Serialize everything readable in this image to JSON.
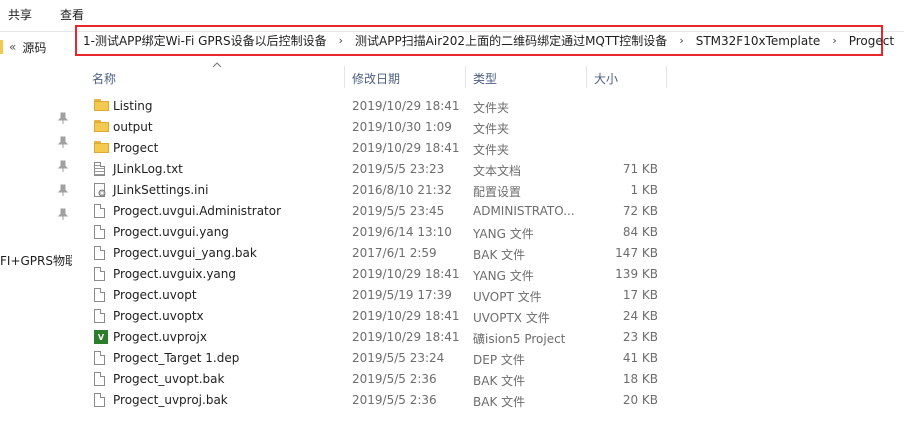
{
  "ribbon": {
    "share": "共享",
    "view": "查看"
  },
  "address": {
    "overflow": "«",
    "root": "源码",
    "crumbs": [
      "1-测试APP绑定Wi-Fi  GPRS设备以后控制设备",
      "测试APP扫描Air202上面的二维码绑定通过MQTT控制设备",
      "STM32F10xTemplate",
      "Progect"
    ],
    "separator": "›"
  },
  "nav": {
    "truncated_item": "FI+GPRS物联"
  },
  "columns": {
    "name": "名称",
    "date": "修改日期",
    "type": "类型",
    "size": "大小"
  },
  "files": [
    {
      "name": "Listing",
      "date": "2019/10/29 18:41",
      "type": "文件夹",
      "size": "",
      "icon": "folder-icon"
    },
    {
      "name": "output",
      "date": "2019/10/30 1:09",
      "type": "文件夹",
      "size": "",
      "icon": "folder-icon"
    },
    {
      "name": "Progect",
      "date": "2019/10/29 18:41",
      "type": "文件夹",
      "size": "",
      "icon": "folder-icon"
    },
    {
      "name": "JLinkLog.txt",
      "date": "2019/5/5 23:23",
      "type": "文本文档",
      "size": "71 KB",
      "icon": "text-file-icon"
    },
    {
      "name": "JLinkSettings.ini",
      "date": "2016/8/10 21:32",
      "type": "配置设置",
      "size": "1 KB",
      "icon": "settings-file-icon"
    },
    {
      "name": "Progect.uvgui.Administrator",
      "date": "2019/5/5 23:45",
      "type": "ADMINISTRATO...",
      "size": "72 KB",
      "icon": "file-icon"
    },
    {
      "name": "Progect.uvgui.yang",
      "date": "2019/6/14 13:10",
      "type": "YANG 文件",
      "size": "84 KB",
      "icon": "file-icon"
    },
    {
      "name": "Progect.uvgui_yang.bak",
      "date": "2017/6/1 2:59",
      "type": "BAK 文件",
      "size": "147 KB",
      "icon": "file-icon"
    },
    {
      "name": "Progect.uvguix.yang",
      "date": "2019/10/29 18:41",
      "type": "YANG 文件",
      "size": "139 KB",
      "icon": "file-icon"
    },
    {
      "name": "Progect.uvopt",
      "date": "2019/5/19 17:39",
      "type": "UVOPT 文件",
      "size": "17 KB",
      "icon": "file-icon"
    },
    {
      "name": "Progect.uvoptx",
      "date": "2019/10/29 18:41",
      "type": "UVOPTX 文件",
      "size": "24 KB",
      "icon": "file-icon"
    },
    {
      "name": "Progect.uvprojx",
      "date": "2019/10/29 18:41",
      "type": "礦ision5 Project",
      "size": "23 KB",
      "icon": "uvision-icon"
    },
    {
      "name": "Progect_Target 1.dep",
      "date": "2019/5/5 23:24",
      "type": "DEP 文件",
      "size": "41 KB",
      "icon": "file-icon"
    },
    {
      "name": "Progect_uvopt.bak",
      "date": "2019/5/5 2:36",
      "type": "BAK 文件",
      "size": "18 KB",
      "icon": "file-icon"
    },
    {
      "name": "Progect_uvproj.bak",
      "date": "2019/5/5 2:36",
      "type": "BAK 文件",
      "size": "20 KB",
      "icon": "file-icon"
    }
  ],
  "colors": {
    "highlight_border": "#e8262b",
    "folder": "#f4c94f",
    "header_text": "#4d6082"
  }
}
